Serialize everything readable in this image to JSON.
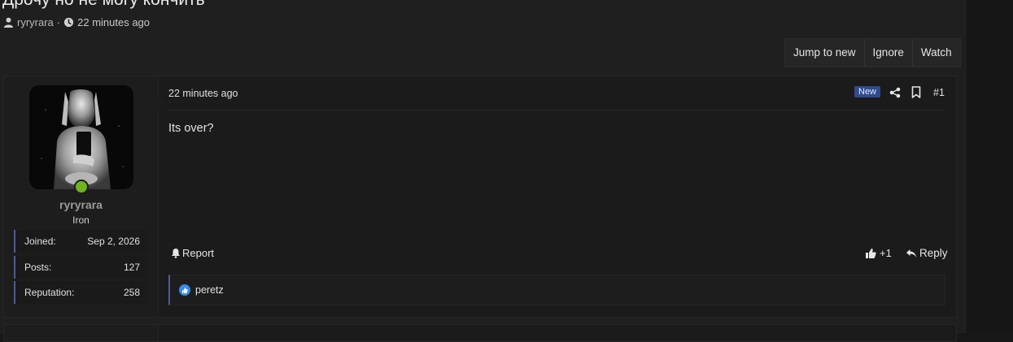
{
  "thread": {
    "title": "Дрочу но не могу кончить",
    "author": "ryryrara",
    "separator": "·",
    "time": "22 minutes ago"
  },
  "actions": {
    "jump_to_new": "Jump to new",
    "ignore": "Ignore",
    "watch": "Watch"
  },
  "post": {
    "date": "22 minutes ago",
    "new_badge": "New",
    "number": "#1",
    "body": "Its over?",
    "report_label": "Report",
    "like_count": "+1",
    "reply_label": "Reply",
    "reactions": {
      "users": "peretz"
    },
    "user": {
      "name": "ryryrara",
      "title": "Iron",
      "stats": [
        {
          "label": "Joined:",
          "value": "Sep 2, 2026"
        },
        {
          "label": "Posts:",
          "value": "127"
        },
        {
          "label": "Reputation:",
          "value": "258"
        }
      ]
    }
  },
  "colors": {
    "accent": "#4d5a9a",
    "new_badge_bg": "#2f4a8d",
    "online": "#6fb31f",
    "reaction": "#3a8ae8"
  },
  "icons": [
    "user-icon",
    "clock-icon",
    "share-icon",
    "bookmark-icon",
    "bell-icon",
    "thumbs-up-icon",
    "reply-icon",
    "like-reaction-icon"
  ]
}
